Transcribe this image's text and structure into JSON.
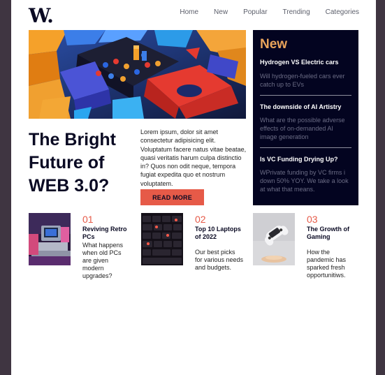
{
  "header": {
    "logo": "W.",
    "nav": [
      "Home",
      "New",
      "Popular",
      "Trending",
      "Categories"
    ]
  },
  "hero": {
    "headline": "The Bright Future of WEB 3.0?",
    "intro": "Lorem ipsum, dolor sit amet consectetur adipisicing elit. Voluptatum facere natus vitae beatae, quasi veritatis harum culpa distinctio in? Quos non odit neque, tempora fugiat expedita quo et nostrum voluptatem.",
    "button_label": "READ MORE"
  },
  "new_panel": {
    "title": "New",
    "items": [
      {
        "title": "Hydrogen VS Electric cars",
        "text": "Will hydrogen-fueled cars ever catch up to EVs"
      },
      {
        "title": "The downside of AI Artistry",
        "text": "What are the possible adverse effects of on-demanded AI image generation"
      },
      {
        "title": "Is VC Funding Drying Up?",
        "text": "WPrivate funding by VC firms i down 50% YOY. We take a look at what that means."
      }
    ]
  },
  "cards": [
    {
      "num": "01",
      "title": "Reviving Retro PCs",
      "text": "What happens when old PCs are given modern upgrades?"
    },
    {
      "num": "02",
      "title": "Top 10 Laptops of 2022",
      "text": "Our best picks for various needs and budgets."
    },
    {
      "num": "03",
      "title": "The Growth of Gaming",
      "text": "How the pandemic has sparked fresh opportunitiws."
    }
  ],
  "colors": {
    "accent": "#e65a48",
    "panel_bg": "#030420",
    "panel_title": "#e9a45b",
    "text_dark": "#0a0a23"
  }
}
